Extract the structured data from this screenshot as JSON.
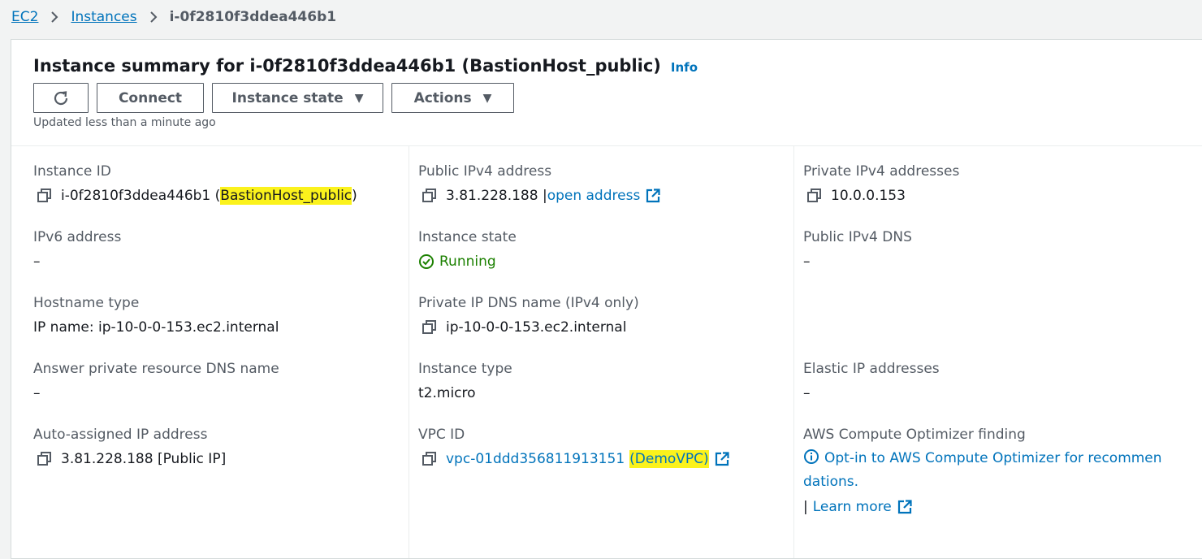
{
  "breadcrumb": {
    "items": [
      "EC2",
      "Instances"
    ],
    "current": "i-0f2810f3ddea446b1"
  },
  "header": {
    "title": "Instance summary for i-0f2810f3ddea446b1 (BastionHost_public)",
    "info": "Info",
    "updated": "Updated less than a minute ago"
  },
  "buttons": {
    "connect": "Connect",
    "instance_state": "Instance state",
    "actions": "Actions"
  },
  "details": {
    "instance_id": {
      "label": "Instance ID",
      "prefix": "i-0f2810f3ddea446b1 (",
      "name": "BastionHost_public",
      "suffix": ")"
    },
    "ipv6": {
      "label": "IPv6 address",
      "value": "–"
    },
    "hostname_type": {
      "label": "Hostname type",
      "value": "IP name: ip-10-0-0-153.ec2.internal"
    },
    "answer_dns": {
      "label": "Answer private resource DNS name",
      "value": "–"
    },
    "auto_ip": {
      "label": "Auto-assigned IP address",
      "value": "3.81.228.188 [Public IP]"
    },
    "public_ipv4": {
      "label": "Public IPv4 address",
      "value": "3.81.228.188 |",
      "link": "open address"
    },
    "instance_state": {
      "label": "Instance state",
      "value": "Running"
    },
    "private_dns": {
      "label": "Private IP DNS name (IPv4 only)",
      "value": "ip-10-0-0-153.ec2.internal"
    },
    "instance_type": {
      "label": "Instance type",
      "value": "t2.micro"
    },
    "vpc_id": {
      "label": "VPC ID",
      "id": "vpc-01ddd356811913151",
      "name": "(DemoVPC)"
    },
    "private_ipv4": {
      "label": "Private IPv4 addresses",
      "value": "10.0.0.153"
    },
    "public_dns": {
      "label": "Public IPv4 DNS",
      "value": "–"
    },
    "elastic_ip": {
      "label": "Elastic IP addresses",
      "value": "–"
    },
    "optimizer": {
      "label": "AWS Compute Optimizer finding",
      "link": "Opt-in to AWS Compute Optimizer for recommen dations.",
      "bar": "|",
      "learn_more": "Learn more"
    }
  },
  "colors": {
    "link": "#0073bb",
    "running": "#1d8102",
    "highlight": "#fbf21c"
  }
}
